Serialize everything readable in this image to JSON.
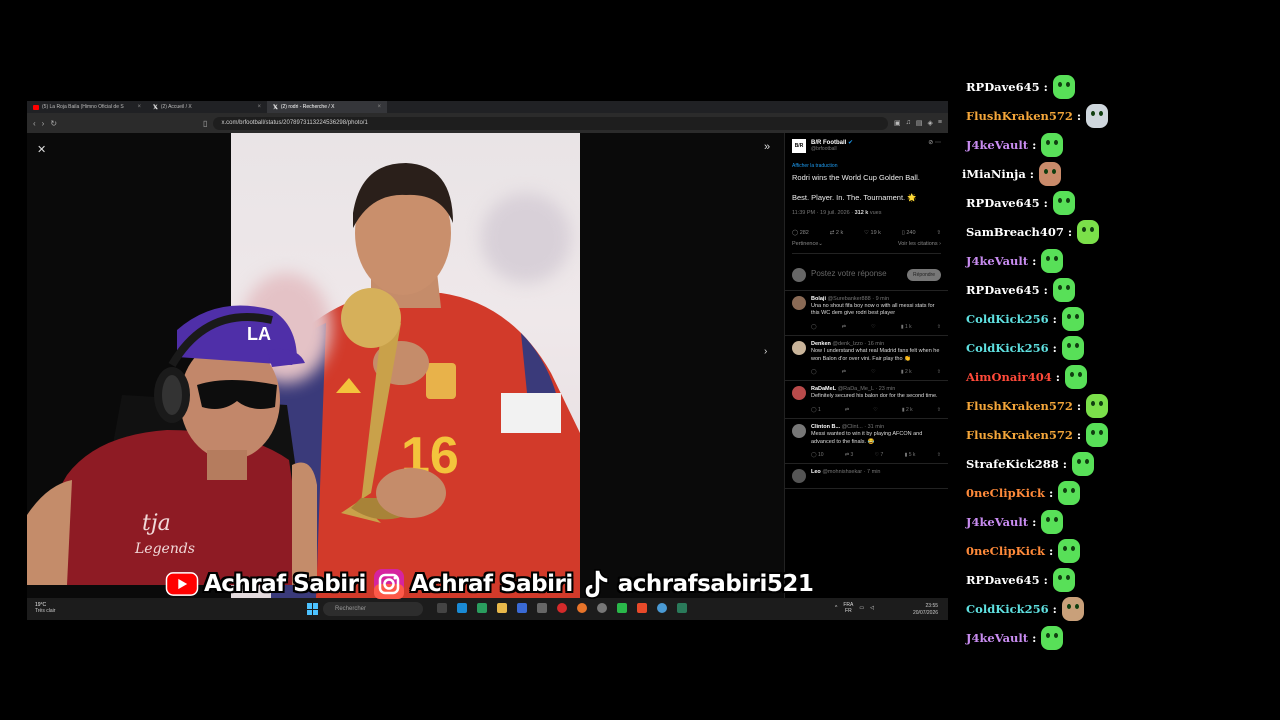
{
  "browser": {
    "tabs": [
      {
        "label": "(5) La Roja Baila (Himno Oficial de S",
        "active": false,
        "icon": "youtube-icon",
        "color": "#ff0000"
      },
      {
        "label": "(2) Accueil / X",
        "active": false,
        "icon": "x-icon",
        "color": "#ffffff"
      },
      {
        "label": "(2) rodri - Recherche / X",
        "active": true,
        "icon": "x-icon",
        "color": "#ffffff"
      }
    ],
    "url": "x.com/brfootball/status/2078973113224536298/photo/1"
  },
  "tweet": {
    "author": "B/R Football",
    "handle": "@brfootball",
    "logo_text": "B/R",
    "translate_label": "Afficher la traduction",
    "line1": "Rodri wins the World Cup Golden Ball.",
    "line2": "Best. Player. In. The. Tournament. 🌟",
    "time": "11:39 PM · 19 juil. 2026 ·",
    "views": "312 k",
    "views_label": "vues",
    "stats": {
      "replies": "282",
      "retweets": "2 k",
      "likes": "19 k",
      "bookmarks": "240"
    },
    "sort_label": "Pertinence",
    "quotes_label": "Voir les citations",
    "reply_placeholder": "Postez votre réponse",
    "reply_button": "Répondre"
  },
  "replies": [
    {
      "name": "Bolaji",
      "meta": "@Surebanker888 · 9 min",
      "text": "Una no shout fifa boy now o with all messi stats for this WC dem give rodri best player",
      "views": "1 k",
      "avatar": "#8a6a55"
    },
    {
      "name": "Denken",
      "meta": "@denk_lzzo · 16 min",
      "text": "Now I understand what real Madrid fans felt when he won Balon d'or over vini. Fair play tho 👏",
      "views": "2 k",
      "avatar": "#c9b49a"
    },
    {
      "name": "RaDaMeL",
      "meta": "@RaDa_Me_L · 23 min",
      "text": "Definitely secured his balon dor for the second time.",
      "replies": "1",
      "views": "2 k",
      "avatar": "#b84a4a"
    },
    {
      "name": "Clinton B...",
      "meta": "@Clint... · 31 min",
      "text": "Messi wanted to win it by playing AFCON and advanced to the finals. 😂",
      "replies": "10",
      "retweets": "3",
      "likes": "7",
      "views": "5 k",
      "avatar": "#777777"
    },
    {
      "name": "Leo",
      "meta": "@mohnishsekar · 7 min",
      "text": "",
      "avatar": "#555555"
    }
  ],
  "taskbar": {
    "temp": "19°C",
    "weather": "Très clair",
    "search_placeholder": "Rechercher",
    "lang_top": "FRA",
    "lang_bottom": "FR",
    "time": "23:55",
    "date": "20/07/2026"
  },
  "socials": [
    {
      "platform": "youtube-icon",
      "label": "Achraf Sabiri"
    },
    {
      "platform": "instagram-icon",
      "label": "Achraf Sabiri"
    },
    {
      "platform": "tiktok-icon",
      "label": "achrafsabiri521"
    }
  ],
  "chat": [
    {
      "user": "RPDave645",
      "color": "#ffffff",
      "emote": "#58e058"
    },
    {
      "user": "FlushKraken572",
      "color": "#f4a63a",
      "emote": "#cfd7dd"
    },
    {
      "user": "J4keVault",
      "color": "#c88cf0",
      "emote": "#58e058"
    },
    {
      "user": "iMiaNinja",
      "color": "#ffffff",
      "emote": "#c98a6a"
    },
    {
      "user": "RPDave645",
      "color": "#ffffff",
      "emote": "#58e058"
    },
    {
      "user": "SamBreach407",
      "color": "#ffffff",
      "emote": "#7be04a"
    },
    {
      "user": "J4keVault",
      "color": "#c88cf0",
      "emote": "#58e058"
    },
    {
      "user": "RPDave645",
      "color": "#ffffff",
      "emote": "#58e058"
    },
    {
      "user": "ColdKick256",
      "color": "#5fe0e0",
      "emote": "#58e058"
    },
    {
      "user": "ColdKick256",
      "color": "#5fe0e0",
      "emote": "#58e058"
    },
    {
      "user": "AimOnair404",
      "color": "#ff4a3a",
      "emote": "#58e058"
    },
    {
      "user": "FlushKraken572",
      "color": "#f4a63a",
      "emote": "#7be04a"
    },
    {
      "user": "FlushKraken572",
      "color": "#f4a63a",
      "emote": "#58e058"
    },
    {
      "user": "StrafeKick288",
      "color": "#ffffff",
      "emote": "#58e058"
    },
    {
      "user": "0neClipKick",
      "color": "#ff8a3a",
      "emote": "#58e058"
    },
    {
      "user": "J4keVault",
      "color": "#c88cf0",
      "emote": "#58e058"
    },
    {
      "user": "0neClipKick",
      "color": "#ff8a3a",
      "emote": "#58e058"
    },
    {
      "user": "RPDave645",
      "color": "#ffffff",
      "emote": "#58e058"
    },
    {
      "user": "ColdKick256",
      "color": "#5fe0e0",
      "emote": "#c9a07a"
    },
    {
      "user": "J4keVault",
      "color": "#c88cf0",
      "emote": "#58e058"
    }
  ]
}
